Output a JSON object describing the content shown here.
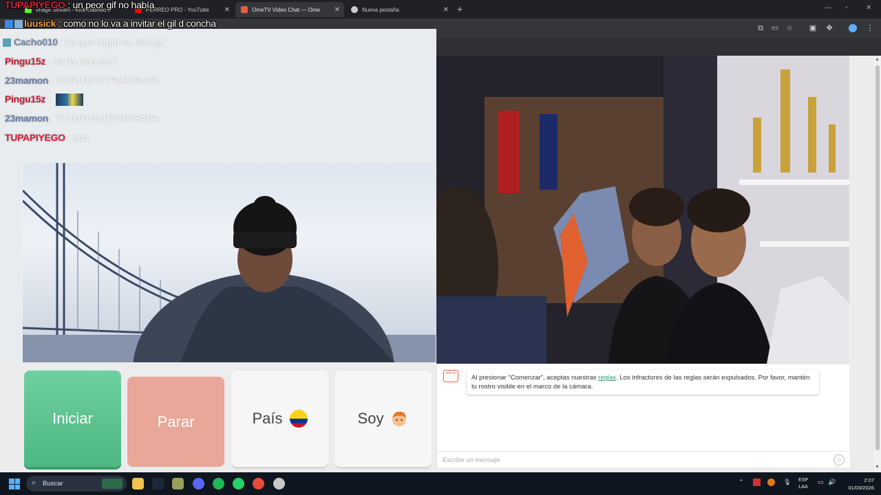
{
  "browser": {
    "tabs": [
      {
        "label": "Image Stream - Kick Dashbo...",
        "active": false,
        "favicon_color": "#53fc18"
      },
      {
        "label": "PERREO PRO - YouTube",
        "active": false,
        "favicon_color": "#ff0000"
      },
      {
        "label": "OmeTV Video Chat — Ome",
        "active": true,
        "favicon_color": "#e06040"
      },
      {
        "label": "Nueva pestaña",
        "active": false,
        "favicon_color": "#cccccc"
      }
    ],
    "new_tab_glyph": "+"
  },
  "stream_chat": [
    {
      "user": "TUPAPIYEGO",
      "text": "un peor gif no había",
      "user_color": "#d8213a",
      "style": "dark"
    },
    {
      "user": "luusick",
      "text": "como no lo va a invitar el gil d concha",
      "user_color": "#f2a23c",
      "style": "dark"
    },
    {
      "user": "Cacho010",
      "text": "de que negro es este gif",
      "user_color": "#7a8ca8",
      "style": "light"
    },
    {
      "user": "Pingu15z",
      "text": "no da mas saul",
      "user_color": "#c41f3a",
      "style": "light"
    },
    {
      "user": "23mamon",
      "text": "TUTUTUTYTPAPAPAPA",
      "user_color": "#6f7fa8",
      "style": "light"
    },
    {
      "user": "Pingu15z",
      "text": "",
      "user_color": "#c41f3a",
      "style": "light",
      "emote": true
    },
    {
      "user": "23mamon",
      "text": "TUTUTUTUTPAPAPAPA",
      "user_color": "#6f7fa8",
      "style": "light"
    },
    {
      "user": "TUPAPIYEGO",
      "text": "apa",
      "user_color": "#d8213a",
      "style": "light"
    }
  ],
  "controls": {
    "start_label": "Iniciar",
    "stop_label": "Parar",
    "country_label": "País",
    "gender_label": "Soy"
  },
  "chat": {
    "system_prefix": "Al presionar \"Comenzar\", aceptas nuestras ",
    "system_link": "reglas",
    "system_suffix": ". Los infractores de las reglas serán expulsados. Por favor, mantén tu rostro visible en el marco de la cámara.",
    "icon_label": "ome tv",
    "input_placeholder": "Escribe un mensaje"
  },
  "taskbar": {
    "search_label": "Buscar",
    "lang_line1": "ESP",
    "lang_line2": "LAA",
    "time": "2:07",
    "date": "01/03/2026"
  }
}
